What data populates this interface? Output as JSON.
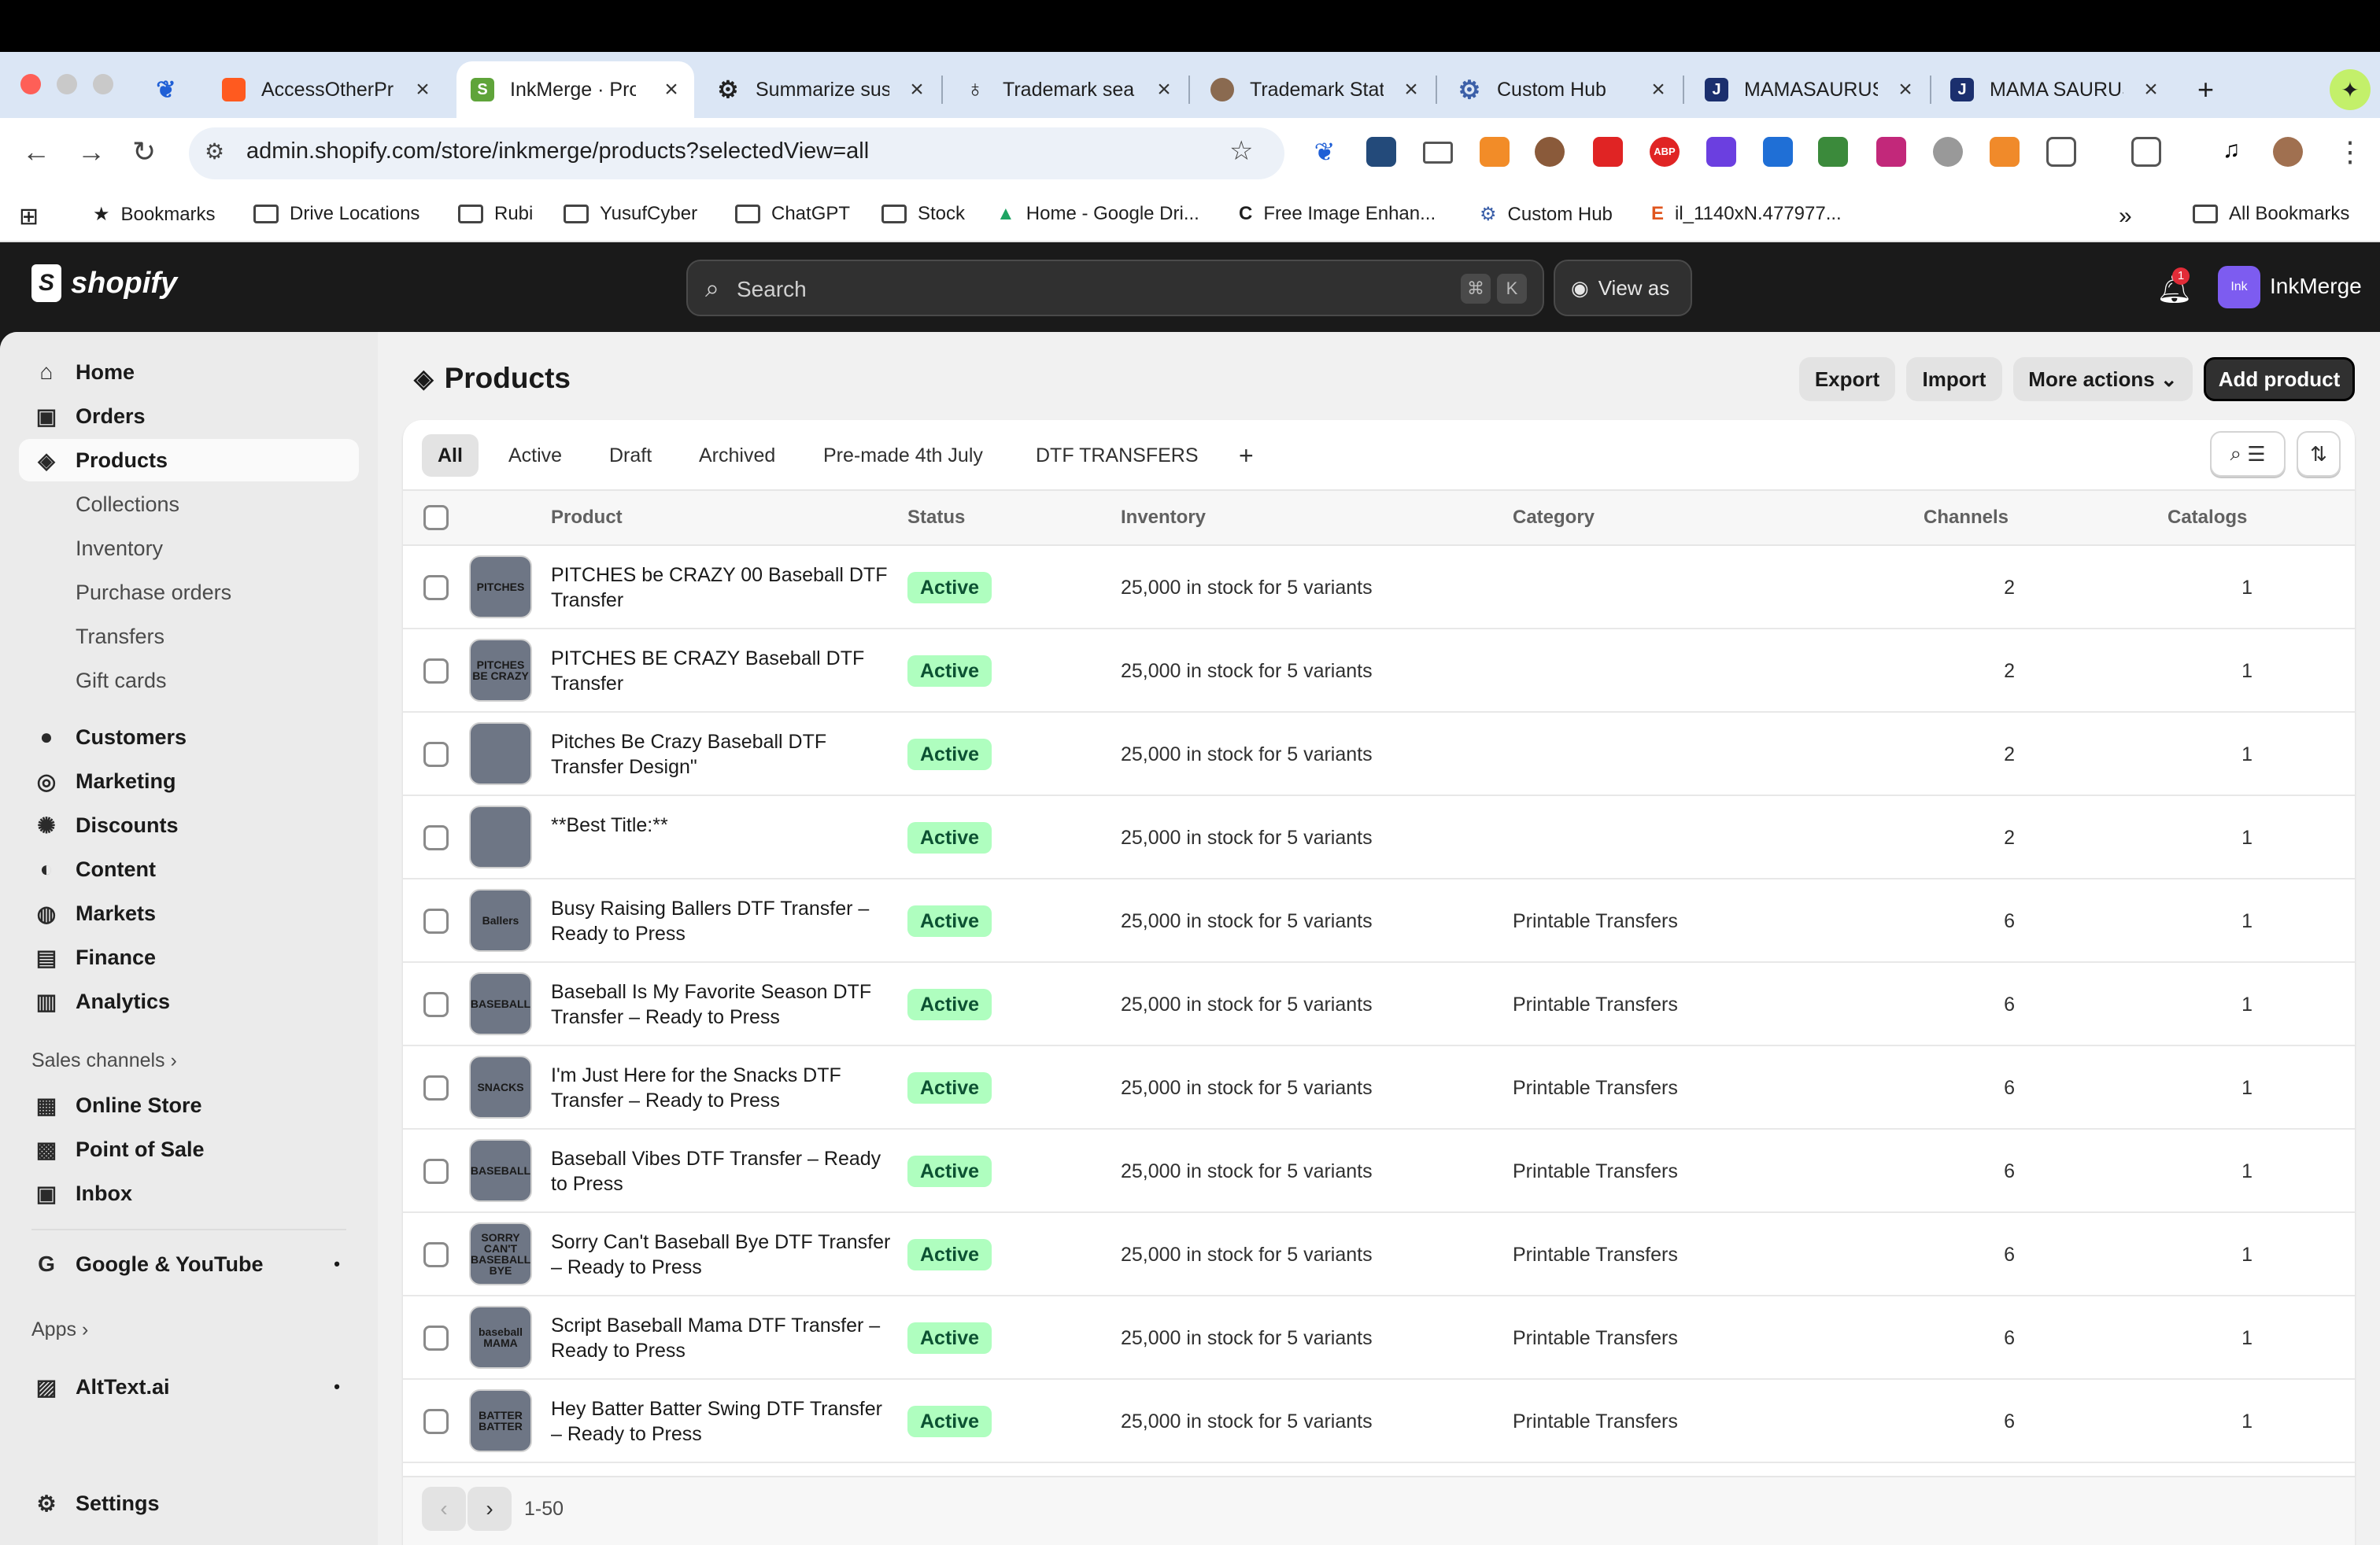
{
  "browser": {
    "tabs": [
      {
        "title": "AccessOtherPr",
        "favicon": "access-icon"
      },
      {
        "title": "InkMerge · Prod",
        "favicon": "shopify-icon"
      },
      {
        "title": "Summarize sus",
        "favicon": "openai-icon"
      },
      {
        "title": "Trademark sea",
        "favicon": "trademark-icon"
      },
      {
        "title": "Trademark Stat",
        "favicon": "trademark-status-icon"
      },
      {
        "title": "Custom Hub",
        "favicon": "gear-icon"
      },
      {
        "title": "MAMASAURUS",
        "favicon": "j-icon"
      },
      {
        "title": "MAMA SAURUS",
        "favicon": "j-icon"
      }
    ],
    "url": "admin.shopify.com/store/inkmerge/products?selectedView=all",
    "bookmarks": [
      "Bookmarks",
      "Drive Locations",
      "Rubi",
      "YusufCyber",
      "ChatGPT",
      "Stock",
      "Home - Google Dri...",
      "Free Image Enhan...",
      "Custom Hub",
      "il_1140xN.477977...",
      "All Bookmarks"
    ]
  },
  "shopify": {
    "logo_text": "shopify",
    "search_placeholder": "Search",
    "shortcut_1": "⌘",
    "shortcut_2": "K",
    "view_as": "View as",
    "notification_count": "1",
    "store_avatar": "Ink",
    "store_name": "InkMerge"
  },
  "sidebar": {
    "items": [
      {
        "label": "Home"
      },
      {
        "label": "Orders"
      },
      {
        "label": "Products"
      },
      {
        "label": "Collections"
      },
      {
        "label": "Inventory"
      },
      {
        "label": "Purchase orders"
      },
      {
        "label": "Transfers"
      },
      {
        "label": "Gift cards"
      },
      {
        "label": "Customers"
      },
      {
        "label": "Marketing"
      },
      {
        "label": "Discounts"
      },
      {
        "label": "Content"
      },
      {
        "label": "Markets"
      },
      {
        "label": "Finance"
      },
      {
        "label": "Analytics"
      }
    ],
    "sales_channels_label": "Sales channels",
    "channels": [
      {
        "label": "Online Store"
      },
      {
        "label": "Point of Sale"
      },
      {
        "label": "Inbox"
      }
    ],
    "google": "Google & YouTube",
    "apps_label": "Apps",
    "apps": [
      {
        "label": "AltText.ai"
      }
    ],
    "settings": "Settings"
  },
  "page": {
    "title": "Products",
    "actions": {
      "export": "Export",
      "import": "Import",
      "more": "More actions",
      "add": "Add product"
    },
    "views": [
      "All",
      "Active",
      "Draft",
      "Archived",
      "Pre-made 4th July",
      "DTF TRANSFERS"
    ],
    "add_view": "+",
    "columns": {
      "product": "Product",
      "status": "Status",
      "inventory": "Inventory",
      "category": "Category",
      "channels": "Channels",
      "catalogs": "Catalogs"
    },
    "rows": [
      {
        "name": "PITCHES be CRAZY 00 Baseball DTF Transfer",
        "thumb": "PITCHES",
        "status": "Active",
        "inventory": "25,000 in stock for 5 variants",
        "category": "",
        "channels": "2",
        "catalogs": "1"
      },
      {
        "name": "PITCHES BE CRAZY Baseball DTF Transfer",
        "thumb": "PITCHES BE CRAZY",
        "status": "Active",
        "inventory": "25,000 in stock for 5 variants",
        "category": "",
        "channels": "2",
        "catalogs": "1"
      },
      {
        "name": "Pitches Be Crazy Baseball DTF Transfer Design\"",
        "thumb": "",
        "status": "Active",
        "inventory": "25,000 in stock for 5 variants",
        "category": "",
        "channels": "2",
        "catalogs": "1"
      },
      {
        "name": "**Best Title:**",
        "thumb": "",
        "status": "Active",
        "inventory": "25,000 in stock for 5 variants",
        "category": "",
        "channels": "2",
        "catalogs": "1"
      },
      {
        "name": "Busy Raising Ballers DTF Transfer – Ready to Press",
        "thumb": "Ballers",
        "status": "Active",
        "inventory": "25,000 in stock for 5 variants",
        "category": "Printable Transfers",
        "channels": "6",
        "catalogs": "1"
      },
      {
        "name": "Baseball Is My Favorite Season DTF Transfer – Ready to Press",
        "thumb": "BASEBALL",
        "status": "Active",
        "inventory": "25,000 in stock for 5 variants",
        "category": "Printable Transfers",
        "channels": "6",
        "catalogs": "1"
      },
      {
        "name": "I'm Just Here for the Snacks DTF Transfer – Ready to Press",
        "thumb": "SNACKS",
        "status": "Active",
        "inventory": "25,000 in stock for 5 variants",
        "category": "Printable Transfers",
        "channels": "6",
        "catalogs": "1"
      },
      {
        "name": "Baseball Vibes DTF Transfer – Ready to Press",
        "thumb": "BASEBALL",
        "status": "Active",
        "inventory": "25,000 in stock for 5 variants",
        "category": "Printable Transfers",
        "channels": "6",
        "catalogs": "1"
      },
      {
        "name": "Sorry Can't Baseball Bye DTF Transfer – Ready to Press",
        "thumb": "SORRY CAN'T BASEBALL BYE",
        "status": "Active",
        "inventory": "25,000 in stock for 5 variants",
        "category": "Printable Transfers",
        "channels": "6",
        "catalogs": "1"
      },
      {
        "name": "Script Baseball Mama DTF Transfer – Ready to Press",
        "thumb": "baseball MAMA",
        "status": "Active",
        "inventory": "25,000 in stock for 5 variants",
        "category": "Printable Transfers",
        "channels": "6",
        "catalogs": "1"
      },
      {
        "name": "Hey Batter Batter Swing DTF Transfer – Ready to Press",
        "thumb": "BATTER BATTER",
        "status": "Active",
        "inventory": "25,000 in stock for 5 variants",
        "category": "Printable Transfers",
        "channels": "6",
        "catalogs": "1"
      }
    ],
    "pagination": "1-50"
  },
  "colors": {
    "status_bg": "#affebf",
    "status_fg": "#0c5132",
    "primary_btn": "#303030"
  }
}
